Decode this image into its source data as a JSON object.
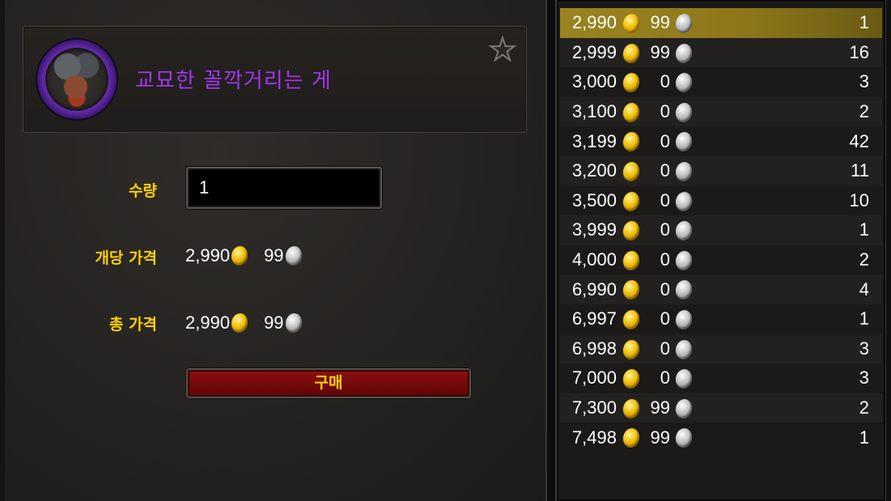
{
  "item": {
    "name": "교묘한 꼴깍거리는 게",
    "quality_color": "#a335ee"
  },
  "purchase": {
    "quantity_label": "수량",
    "quantity_value": "1",
    "unit_price_label": "개당 가격",
    "unit_price_gold": "2,990",
    "unit_price_silver": "99",
    "total_price_label": "총 가격",
    "total_price_gold": "2,990",
    "total_price_silver": "99",
    "buy_label": "구매"
  },
  "icons": {
    "favorite": "star-outline-icon",
    "gold": "gold-coin-icon",
    "silver": "silver-coin-icon"
  },
  "listings": [
    {
      "gold": "2,990",
      "silver": "99",
      "qty": "1",
      "selected": true
    },
    {
      "gold": "2,999",
      "silver": "99",
      "qty": "16"
    },
    {
      "gold": "3,000",
      "silver": "0",
      "qty": "3"
    },
    {
      "gold": "3,100",
      "silver": "0",
      "qty": "2"
    },
    {
      "gold": "3,199",
      "silver": "0",
      "qty": "42"
    },
    {
      "gold": "3,200",
      "silver": "0",
      "qty": "11"
    },
    {
      "gold": "3,500",
      "silver": "0",
      "qty": "10"
    },
    {
      "gold": "3,999",
      "silver": "0",
      "qty": "1"
    },
    {
      "gold": "4,000",
      "silver": "0",
      "qty": "2"
    },
    {
      "gold": "6,990",
      "silver": "0",
      "qty": "4"
    },
    {
      "gold": "6,997",
      "silver": "0",
      "qty": "1"
    },
    {
      "gold": "6,998",
      "silver": "0",
      "qty": "3"
    },
    {
      "gold": "7,000",
      "silver": "0",
      "qty": "3"
    },
    {
      "gold": "7,300",
      "silver": "99",
      "qty": "2"
    },
    {
      "gold": "7,498",
      "silver": "99",
      "qty": "1"
    }
  ]
}
